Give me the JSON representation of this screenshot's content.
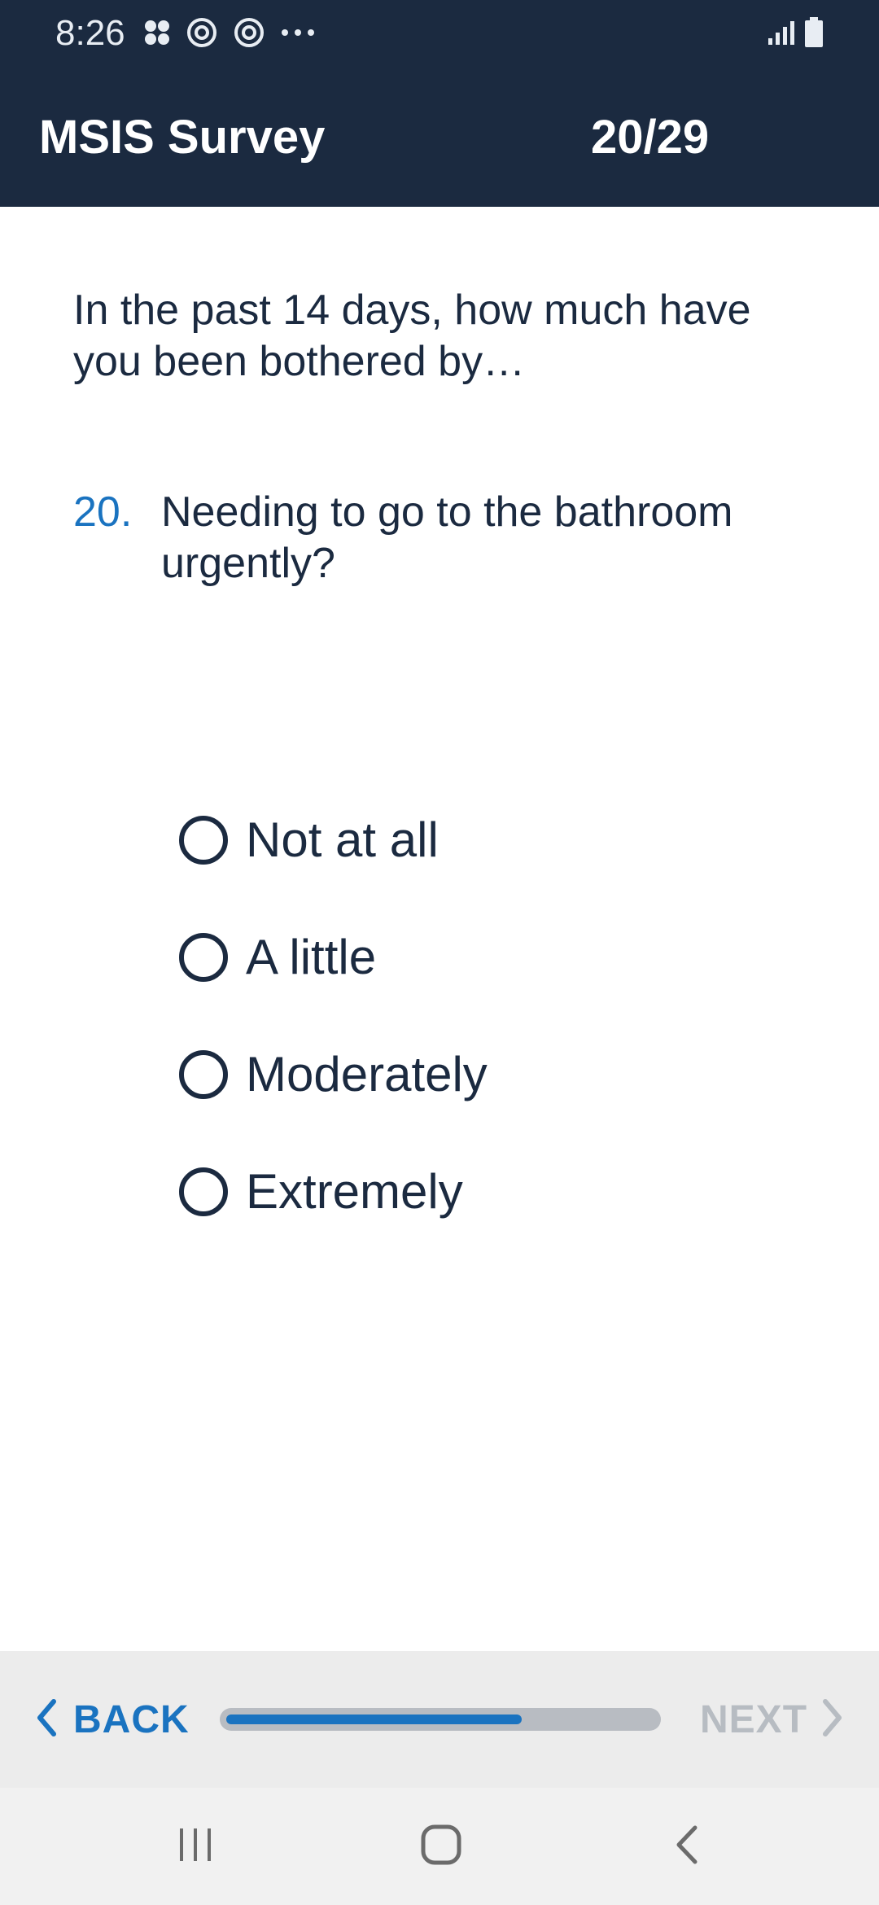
{
  "status_bar": {
    "time": "8:26",
    "left_icons": [
      "app-grid-icon",
      "sync-icon",
      "sync-icon",
      "more-dots-icon"
    ],
    "right_icons": [
      "signal-icon",
      "battery-icon"
    ]
  },
  "header": {
    "title": "MSIS Survey",
    "counter": "20/29"
  },
  "survey": {
    "intro": "In the past 14 days, how much have you been bothered by…",
    "question_number": "20.",
    "question_text": "Needing to go to the bathroom urgently?",
    "options": [
      {
        "label": "Not at all",
        "selected": false
      },
      {
        "label": "A little",
        "selected": false
      },
      {
        "label": "Moderately",
        "selected": false
      },
      {
        "label": "Extremely",
        "selected": false
      }
    ]
  },
  "footer": {
    "back_label": "BACK",
    "next_label": "NEXT",
    "next_enabled": false,
    "progress": 0.69,
    "accent_color": "#1a73c0",
    "disabled_color": "#b7bcc2"
  },
  "nav_bar": {
    "items": [
      "recent-apps-icon",
      "home-icon",
      "back-icon"
    ]
  },
  "colors": {
    "header_bg": "#1b2a40",
    "text": "#1b2a40",
    "accent": "#1a73c0"
  }
}
